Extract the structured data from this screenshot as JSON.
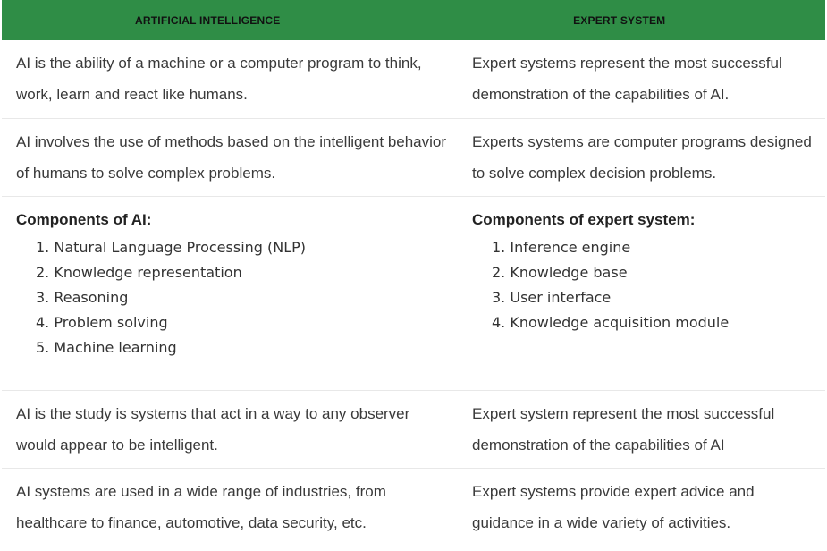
{
  "header": {
    "col_ai": "ARTIFICIAL INTELLIGENCE",
    "col_es": "EXPERT SYSTEM"
  },
  "rows": [
    {
      "ai": "AI is the ability of a machine or a computer program to think, work, learn and react like humans.",
      "es": "Expert systems represent the most successful demonstration of the capabilities of AI."
    },
    {
      "ai": "AI involves the use of methods based on the intelligent behavior of humans to solve complex problems.",
      "es": "Experts systems are computer programs designed to solve complex decision problems."
    },
    {
      "ai_title": "Components of AI:",
      "ai_items": [
        "1. Natural Language Processing (NLP)",
        "2. Knowledge representation",
        "3. Reasoning",
        "4. Problem solving",
        "5. Machine learning"
      ],
      "es_title": "Components of expert system:",
      "es_items": [
        "1. Inference engine",
        "2. Knowledge base",
        "3. User interface",
        "4. Knowledge acquisition module"
      ]
    },
    {
      "ai": "AI is the study is systems that act in a way to any observer would appear to be intelligent.",
      "es": "Expert system represent the most successful demonstration of the capabilities of AI"
    },
    {
      "ai": "AI systems are used in a wide range of industries, from healthcare to finance, automotive, data security, etc.",
      "es": "Expert systems provide expert advice and guidance in a wide variety of activities."
    }
  ],
  "colors": {
    "header_bg": "#2f8d46",
    "row_divider": "#e8e8e8"
  }
}
